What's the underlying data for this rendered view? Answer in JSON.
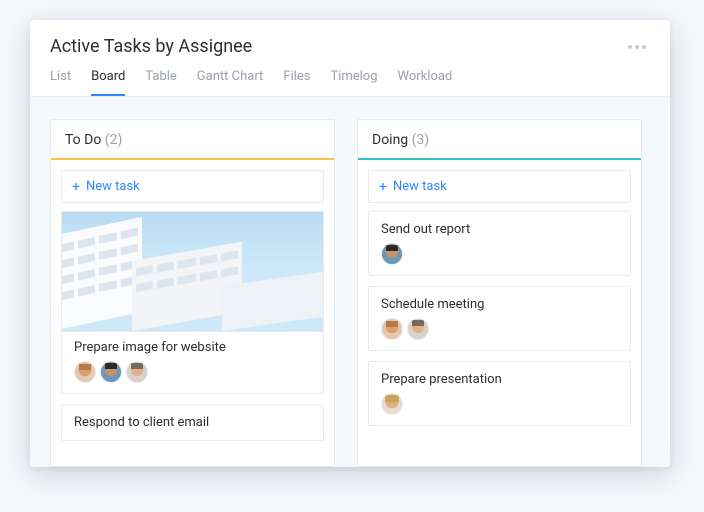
{
  "header": {
    "title": "Active Tasks by Assignee"
  },
  "tabs": [
    {
      "label": "List",
      "active": false
    },
    {
      "label": "Board",
      "active": true
    },
    {
      "label": "Table",
      "active": false
    },
    {
      "label": "Gantt Chart",
      "active": false
    },
    {
      "label": "Files",
      "active": false
    },
    {
      "label": "Timelog",
      "active": false
    },
    {
      "label": "Workload",
      "active": false
    }
  ],
  "new_task_label": "New task",
  "columns": {
    "todo": {
      "title": "To Do",
      "count": "(2)",
      "cards": [
        {
          "title": "Prepare image for website"
        },
        {
          "title": "Respond to client email"
        }
      ]
    },
    "doing": {
      "title": "Doing",
      "count": "(3)",
      "cards": [
        {
          "title": "Send out report"
        },
        {
          "title": "Schedule meeting"
        },
        {
          "title": "Prepare presentation"
        }
      ]
    }
  }
}
